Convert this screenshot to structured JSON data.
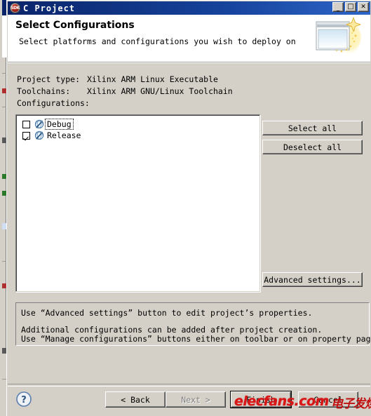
{
  "window": {
    "title": "C Project",
    "icon": "sdk-badge-icon",
    "icon_text": "SDK",
    "controls": {
      "minimize": "_",
      "maximize": "□",
      "close": "✕"
    }
  },
  "header": {
    "title": "Select Configurations",
    "subtitle": "Select platforms and configurations you wish to deploy on",
    "banner_icon": "new-window-sparkle-icon"
  },
  "info": [
    {
      "label": "Project type:",
      "value": "Xilinx ARM Linux Executable"
    },
    {
      "label": "Toolchains:",
      "value": "Xilinx ARM GNU/Linux Toolchain"
    },
    {
      "label": "Configurations:",
      "value": ""
    }
  ],
  "configurations": [
    {
      "label": "Debug",
      "checked": false,
      "focused": true,
      "icon": "configuration-icon"
    },
    {
      "label": "Release",
      "checked": true,
      "focused": false,
      "icon": "configuration-icon"
    }
  ],
  "side_buttons": [
    {
      "label": "Select all",
      "name": "select-all-button",
      "enabled": true
    },
    {
      "label": "Deselect all",
      "name": "deselect-all-button",
      "enabled": true
    }
  ],
  "advanced_button": {
    "label": "Advanced settings...",
    "enabled": true
  },
  "description": {
    "line1": "Use “Advanced settings” button to edit project’s properties.",
    "line2": "Additional configurations can be added after project creation.",
    "line3": "Use “Manage configurations” buttons either on toolbar or on property pages."
  },
  "footer": {
    "help_icon": "help-question-icon",
    "buttons": [
      {
        "label": "< Back",
        "name": "back-button",
        "enabled": true,
        "default": false
      },
      {
        "label": "Next >",
        "name": "next-button",
        "enabled": false,
        "default": false
      },
      {
        "label": "Finish",
        "name": "finish-button",
        "enabled": true,
        "default": true
      },
      {
        "label": "Cancel",
        "name": "cancel-button",
        "enabled": true,
        "default": false
      }
    ]
  },
  "watermark": {
    "latin": "elecfans.com",
    "chinese": "电子发烧友",
    "color": "#d81616"
  },
  "colors": {
    "dialog_face": "#d4d0c8",
    "titlebar_start": "#0a246a",
    "titlebar_end": "#2e65c8",
    "field_bg": "#ffffff",
    "disabled_text": "#808080"
  }
}
